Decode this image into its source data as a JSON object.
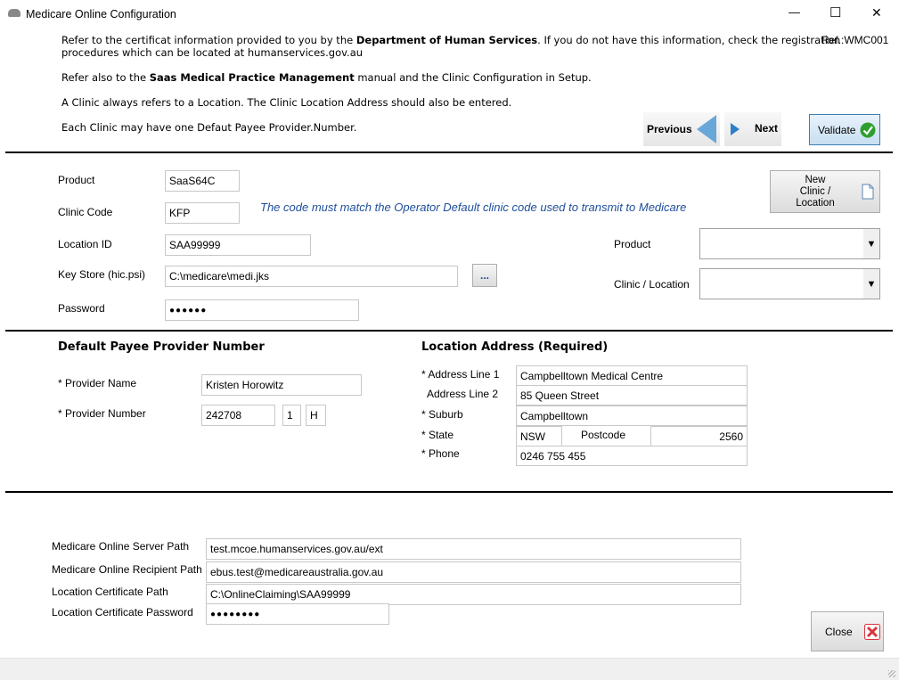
{
  "window": {
    "title": "Medicare Online Configuration",
    "minimize": "—",
    "maximize": "☐",
    "close": "✕"
  },
  "ref": "Ref.:WMC001",
  "info": {
    "l1_pre": "Refer to the certificat information provided to you by the ",
    "l1_bold": "Department of Human Services",
    "l1_post": ". If you do not have this information, check the registration",
    "l2": "procedures which can be located at humanservices.gov.au",
    "l3_pre": "Refer also to the ",
    "l3_bold": "Saas Medical Practice Management",
    "l3_post": "  manual and the Clinic Configuration in Setup.",
    "l4": "A Clinic always refers to a Location. The Clinic Location Address should also be entered.",
    "l5": "Each Clinic may have one Defaut Payee Provider.Number."
  },
  "nav": {
    "previous": "Previous",
    "next": "Next",
    "validate": "Validate"
  },
  "config": {
    "product_label": "Product",
    "product_value": "SaaS64C",
    "clinic_code_label": "Clinic Code",
    "clinic_code_value": "KFP",
    "clinic_note": "The code must match the Operator Default clinic code used to transmit to Medicare",
    "location_id_label": "Location ID",
    "location_id_value": "SAA99999",
    "keystore_label": "Key Store (hic.psi)",
    "keystore_value": "C:\\medicare\\medi.jks",
    "browse": "...",
    "password_label": "Password",
    "password_value": "●●●●●●",
    "new_clinic_l1": "New",
    "new_clinic_l2": "Clinic /",
    "new_clinic_l3": "Location",
    "product_combo_label": "Product",
    "clinic_combo_label": "Clinic / Location"
  },
  "payee": {
    "heading": "Default Payee Provider Number",
    "name_label": "* Provider Name",
    "name_value": "Kristen Horowitz",
    "number_label": "* Provider Number",
    "number_value": "242708",
    "number_check": "1",
    "number_suffix": "H"
  },
  "address": {
    "heading": "Location Address (Required)",
    "line1_label": "* Address Line 1",
    "line1_value": "Campbelltown Medical Centre",
    "line2_label": "Address Line 2",
    "line2_value": "85 Queen Street",
    "suburb_label": "* Suburb",
    "suburb_value": "Campbelltown",
    "state_label": "* State",
    "state_value": "NSW",
    "postcode_label": "Postcode",
    "postcode_value": "2560",
    "phone_label": "* Phone",
    "phone_value": "0246 755 455"
  },
  "server": {
    "server_path_label": "Medicare Online Server Path",
    "server_path_value": "test.mcoe.humanservices.gov.au/ext",
    "recipient_label": "Medicare Online Recipient Path",
    "recipient_value": "ebus.test@medicareaustralia.gov.au",
    "cert_path_label": "Location Certificate Path",
    "cert_path_value": "C:\\OnlineClaiming\\SAA99999",
    "cert_pw_label": "Location Certificate Password",
    "cert_pw_value": "●●●●●●●●"
  },
  "close_button": "Close",
  "colors": {
    "accent_blue": "#1f4e9a",
    "validate_check": "#2e9e2e",
    "close_x": "#d9363e"
  }
}
